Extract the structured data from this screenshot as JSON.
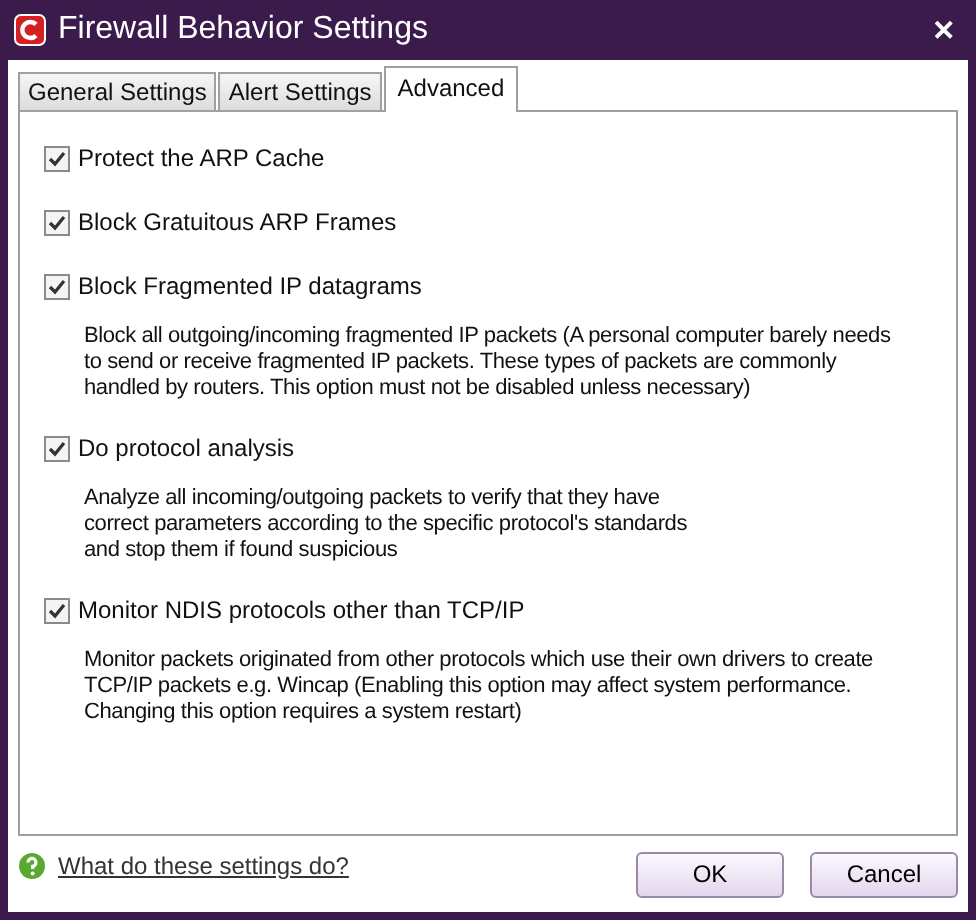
{
  "window": {
    "title": "Firewall Behavior Settings",
    "close": "✕"
  },
  "tabs": [
    {
      "label": "General Settings",
      "selected": false
    },
    {
      "label": "Alert Settings",
      "selected": false
    },
    {
      "label": "Advanced",
      "selected": true
    }
  ],
  "options": [
    {
      "label": "Protect the ARP Cache",
      "checked": true
    },
    {
      "label": "Block Gratuitous ARP Frames",
      "checked": true
    },
    {
      "label": "Block Fragmented IP datagrams",
      "checked": true,
      "description": "Block all outgoing/incoming fragmented IP packets (A personal computer barely needs\nto send or receive fragmented IP packets. These types of packets are commonly\nhandled by routers. This option must not be disabled unless necessary)"
    },
    {
      "label": "Do protocol analysis",
      "checked": true,
      "description": "Analyze all incoming/outgoing packets to verify that they have\ncorrect parameters according to the specific protocol's standards\nand stop them if found suspicious"
    },
    {
      "label": "Monitor NDIS protocols other than TCP/IP",
      "checked": true,
      "description": "Monitor packets originated from other protocols which use their own drivers to create\nTCP/IP packets e.g. Wincap (Enabling this option may affect system performance.\nChanging this option requires a system restart)"
    }
  ],
  "help_link": "What do these settings do?",
  "buttons": [
    "OK",
    "Cancel"
  ]
}
